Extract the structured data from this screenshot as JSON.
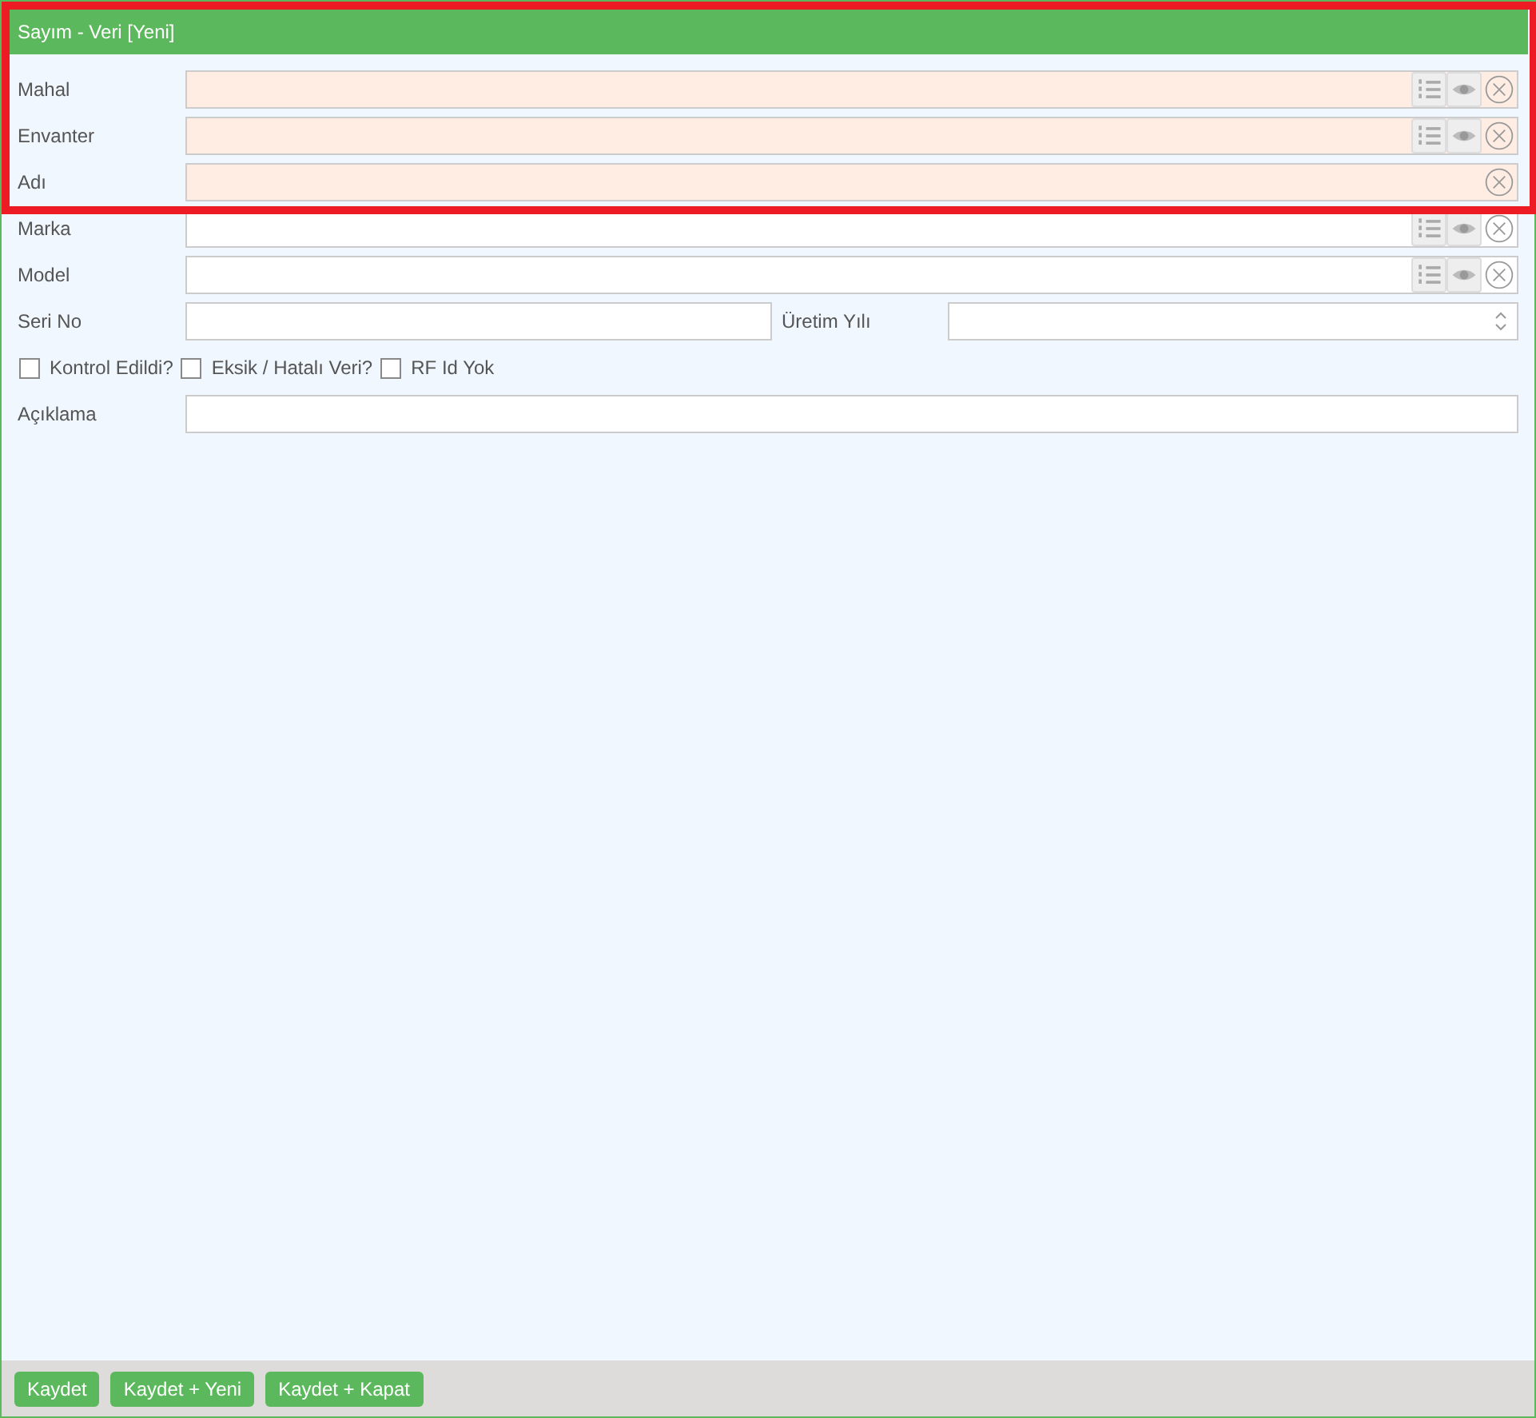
{
  "window": {
    "title": "Sayım - Veri [Yeni]"
  },
  "highlight_frame": true,
  "fields": [
    {
      "label": "Mahal",
      "kind": "lookup",
      "required": true
    },
    {
      "label": "Envanter",
      "kind": "lookup",
      "required": true
    },
    {
      "label": "Adı",
      "kind": "clearable",
      "required": true
    },
    {
      "label": "Marka",
      "kind": "lookup",
      "required": false
    },
    {
      "label": "Model",
      "kind": "lookup",
      "required": false
    }
  ],
  "serial": {
    "label": "Seri No"
  },
  "year": {
    "label": "Üretim Yılı"
  },
  "checkboxes": [
    {
      "label": "Kontrol Edildi?",
      "checked": false
    },
    {
      "label": "Eksik / Hatalı Veri?",
      "checked": false
    },
    {
      "label": "RF Id Yok",
      "checked": false
    }
  ],
  "description": {
    "label": "Açıklama"
  },
  "buttons": [
    "Kaydet",
    "Kaydet + Yeni",
    "Kaydet + Kapat"
  ]
}
